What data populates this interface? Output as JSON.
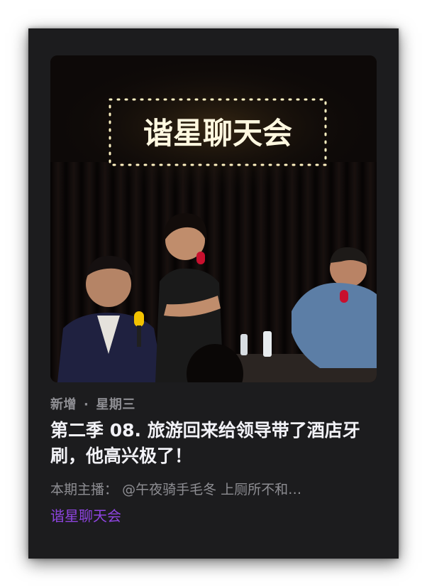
{
  "episode": {
    "status": "新增",
    "separator": "·",
    "day": "星期三",
    "title": "第二季 08. 旅游回来给领导带了酒店牙刷，他高兴极了！",
    "hosts_label": "本期主播：",
    "hosts": "@午夜骑手毛冬 上厕所不和…",
    "podcast_name": "谐星聊天会"
  },
  "artwork": {
    "sign_text": "谐星聊天会",
    "icon": "podcast-cover-artwork",
    "colors": {
      "background": "#0d0908",
      "sign_glow": "#ffe9a8",
      "mic_yellow": "#f2c200",
      "mic_red": "#c8102e"
    }
  },
  "theme": {
    "card_background": "#1c1c1e",
    "accent": "#8e44e0",
    "secondary_text": "#8e8e93",
    "primary_text": "#f2f2f7"
  }
}
